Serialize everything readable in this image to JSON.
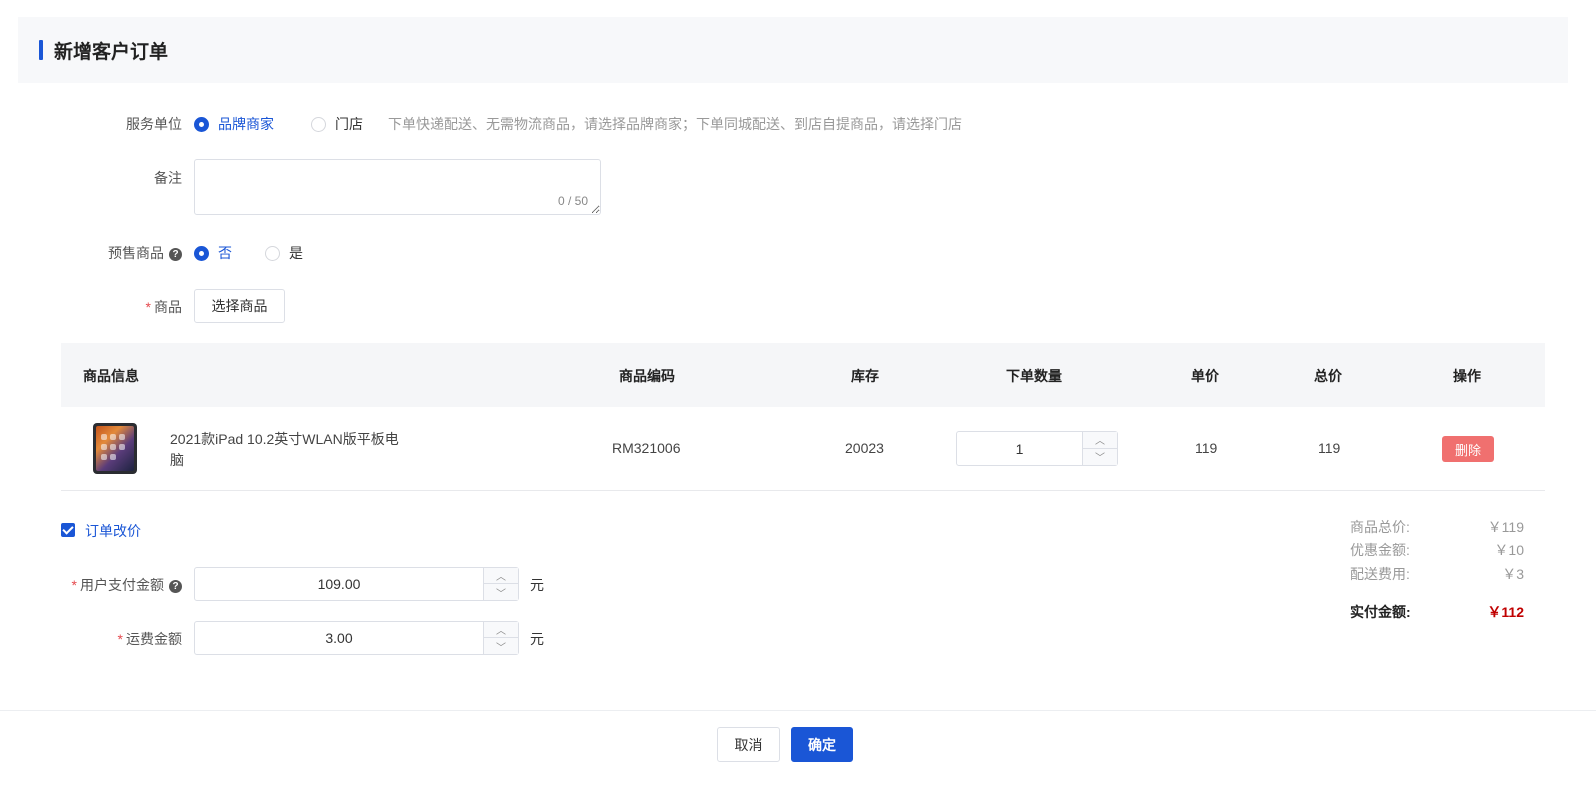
{
  "header": {
    "title": "新增客户订单"
  },
  "service_unit": {
    "label": "服务单位",
    "options": [
      {
        "label": "品牌商家",
        "selected": true
      },
      {
        "label": "门店",
        "selected": false
      }
    ],
    "hint": "下单快递配送、无需物流商品，请选择品牌商家；下单同城配送、到店自提商品，请选择门店"
  },
  "memo": {
    "label": "备注",
    "value": "",
    "counter": "0 / 50"
  },
  "presale": {
    "label": "预售商品",
    "help_icon": "question-circle-icon",
    "options": [
      {
        "label": "否",
        "selected": true
      },
      {
        "label": "是",
        "selected": false
      }
    ]
  },
  "product": {
    "required_mark": "*",
    "label": "商品",
    "select_button": "选择商品"
  },
  "table": {
    "headers": {
      "info": "商品信息",
      "code": "商品编码",
      "stock": "库存",
      "qty": "下单数量",
      "price": "单价",
      "total": "总价",
      "ops": "操作"
    },
    "rows": [
      {
        "name_line1": "2021款iPad 10.2英寸WLAN版平板电",
        "name_line2": "脑",
        "code": "RM321006",
        "stock": "20023",
        "qty": "1",
        "price": "119",
        "total": "119",
        "delete_label": "删除"
      }
    ]
  },
  "reprice": {
    "checked": true,
    "label": "订单改价"
  },
  "user_pay": {
    "required_mark": "*",
    "label": "用户支付金额",
    "value": "109.00",
    "unit": "元"
  },
  "freight": {
    "required_mark": "*",
    "label": "运费金额",
    "value": "3.00",
    "unit": "元"
  },
  "summary": {
    "goods_total_label": "商品总价:",
    "goods_total_value": "￥119",
    "discount_label": "优惠金额:",
    "discount_value": "￥10",
    "delivery_label": "配送费用:",
    "delivery_value": "￥3",
    "paid_label": "实付金额:",
    "paid_value": "￥112",
    "accent_color": "#c00000"
  },
  "footer": {
    "cancel_label": "取消",
    "confirm_label": "确定"
  },
  "colors": {
    "primary": "#1a56d6",
    "danger": "#f0706f"
  }
}
